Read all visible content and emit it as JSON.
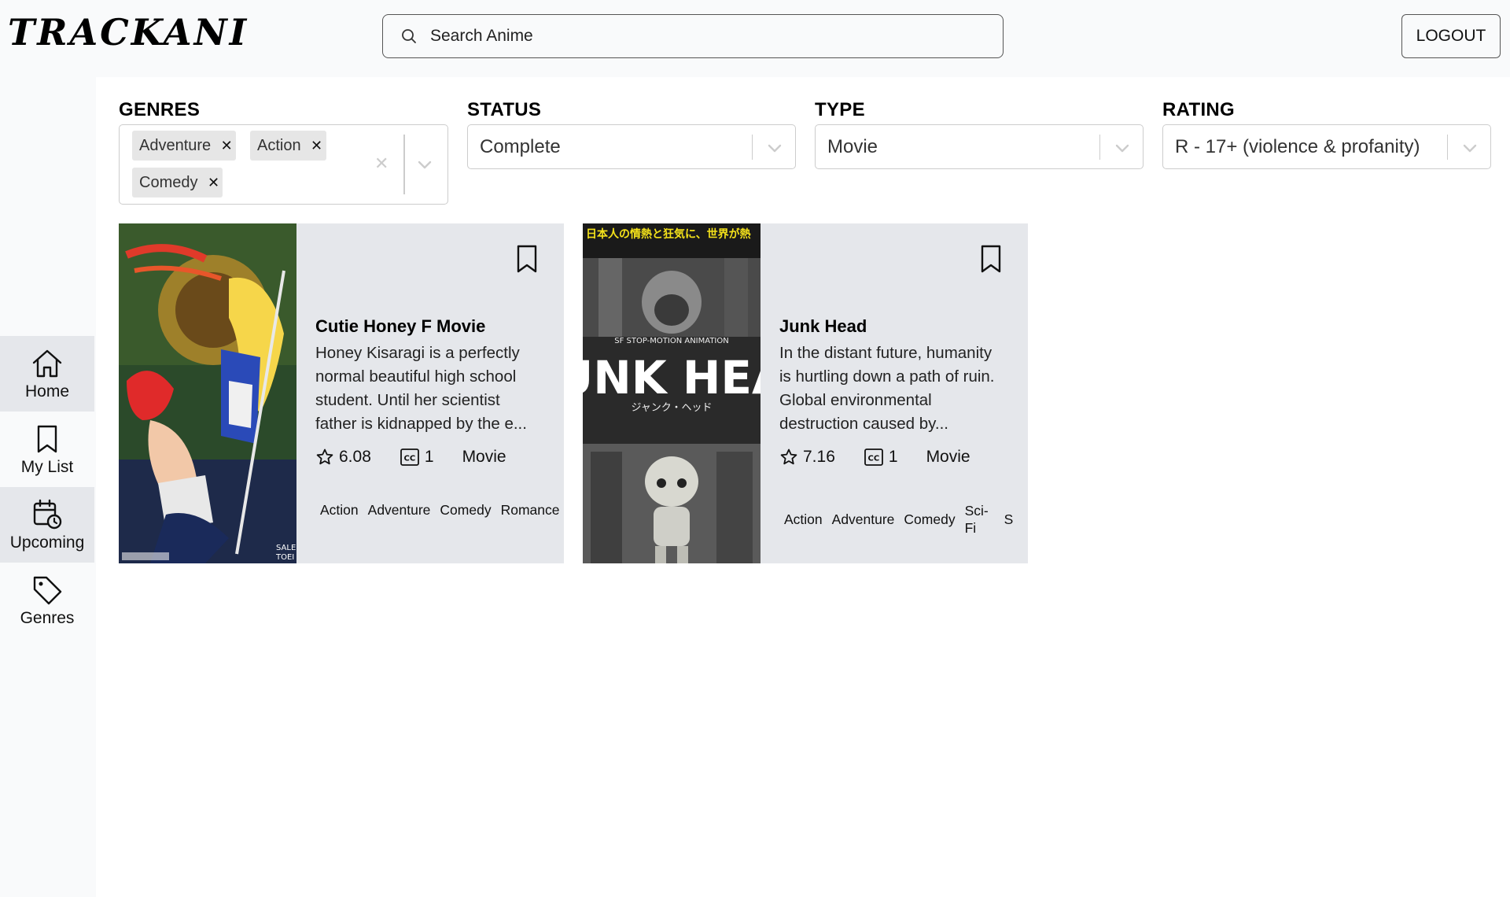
{
  "header": {
    "logo": "TRACKANI",
    "search_placeholder": "Search Anime",
    "logout_label": "LOGOUT"
  },
  "sidebar": {
    "items": [
      {
        "label": "Home",
        "icon": "home-icon",
        "active": true
      },
      {
        "label": "My List",
        "icon": "bookmark-icon",
        "active": false
      },
      {
        "label": "Upcoming",
        "icon": "calendar-clock-icon",
        "active": true
      },
      {
        "label": "Genres",
        "icon": "tag-icon",
        "active": false
      }
    ]
  },
  "filters": {
    "genres": {
      "label": "GENRES",
      "selected": [
        "Adventure",
        "Action",
        "Comedy"
      ]
    },
    "status": {
      "label": "STATUS",
      "value": "Complete"
    },
    "type": {
      "label": "TYPE",
      "value": "Movie"
    },
    "rating": {
      "label": "RATING",
      "value": "R - 17+ (violence & profanity)"
    }
  },
  "results": [
    {
      "title": "Cutie Honey F Movie",
      "synopsis": "Honey Kisaragi is a perfectly normal beautiful high school student. Until her scientist father is kidnapped by the e...",
      "score": "6.08",
      "episodes": "1",
      "type": "Movie",
      "tags": [
        "Action",
        "Adventure",
        "Comedy",
        "Romance"
      ],
      "poster_colors": [
        "#2b4a2a",
        "#d8b23a",
        "#c8362a"
      ]
    },
    {
      "title": "Junk Head",
      "synopsis": "In the distant future, humanity is hurtling down a path of ruin. Global environmental destruction caused by...",
      "score": "7.16",
      "episodes": "1",
      "type": "Movie",
      "tags": [
        "Action",
        "Adventure",
        "Comedy",
        "Sci-Fi",
        "S"
      ],
      "poster_text": "UNK HEA",
      "poster_caption": "ジャンク・ヘッド",
      "poster_top_text": "日本人の情熱と狂気に、世界が熱",
      "poster_sub": "SF STOP-MOTION ANIMATION",
      "poster_colors": [
        "#1a1a1a",
        "#f4e21a",
        "#6b6b6b"
      ]
    }
  ]
}
